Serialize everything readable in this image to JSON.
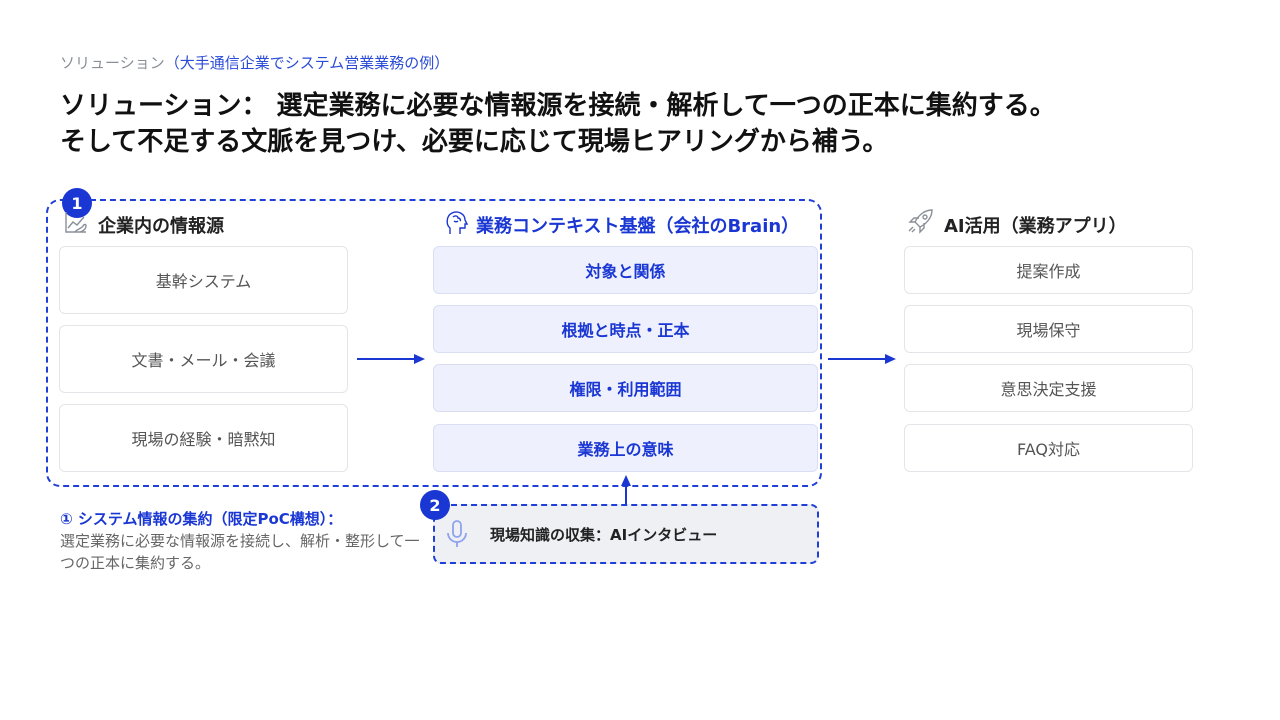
{
  "header": {
    "subtitle_prefix": "ソリューション",
    "subtitle_accent": "（大手通信企業でシステム営業業務の例）",
    "title_line1": "ソリューション： 選定業務に必要な情報源を接続・解析して一つの正本に集約する。",
    "title_line2": "そして不足する文脈を見つけ、必要に応じて現場ヒアリングから補う。"
  },
  "badges": {
    "one": "1",
    "two": "2"
  },
  "sources": {
    "heading": "企業内の情報源",
    "icon": "chart-hand-icon",
    "items": [
      "基幹システム",
      "文書・メール・会議",
      "現場の経験・暗黙知"
    ]
  },
  "context": {
    "heading": "業務コンテキスト基盤（会社のBrain）",
    "icon": "brain-head-icon",
    "items": [
      "対象と関係",
      "根拠と時点・正本",
      "権限・利用範囲",
      "業務上の意味"
    ]
  },
  "apps": {
    "heading": "AI活用（業務アプリ）",
    "icon": "rocket-icon",
    "items": [
      "提案作成",
      "現場保守",
      "意思決定支援",
      "FAQ対応"
    ]
  },
  "note": {
    "heading": "① システム情報の集約（限定PoC構想）：",
    "body": "選定業務に必要な情報源を接続し、解析・整形して一つの正本に集約する。"
  },
  "interview": {
    "icon": "microphone-icon",
    "label": "現場知識の収集：AIインタビュー"
  },
  "colors": {
    "accent": "#1a37d3",
    "box_fill": "#eef1fd",
    "interview_fill": "#eef0f4"
  }
}
